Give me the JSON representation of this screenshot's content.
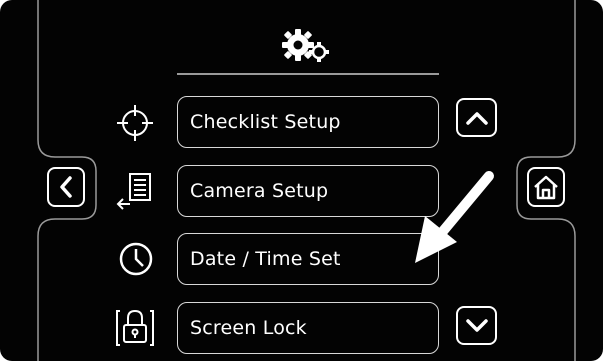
{
  "header": {
    "icon": "gears-icon"
  },
  "menu": {
    "items": [
      {
        "label": "Checklist Setup",
        "icon": "crosshair-icon"
      },
      {
        "label": "Camera Setup",
        "icon": "document-export-icon"
      },
      {
        "label": "Date / Time Set",
        "icon": "clock-icon"
      },
      {
        "label": "Screen Lock",
        "icon": "padlock-icon"
      }
    ]
  },
  "navigation": {
    "back": "chevron-left-icon",
    "home": "home-icon",
    "scroll_up": "chevron-up-icon",
    "scroll_down": "chevron-down-icon"
  },
  "annotation": {
    "type": "arrow",
    "color": "#ffffff",
    "points_to": "Date / Time Set"
  },
  "colors": {
    "background": "#030303",
    "foreground": "#ffffff",
    "frame": "#9a9a9a"
  }
}
